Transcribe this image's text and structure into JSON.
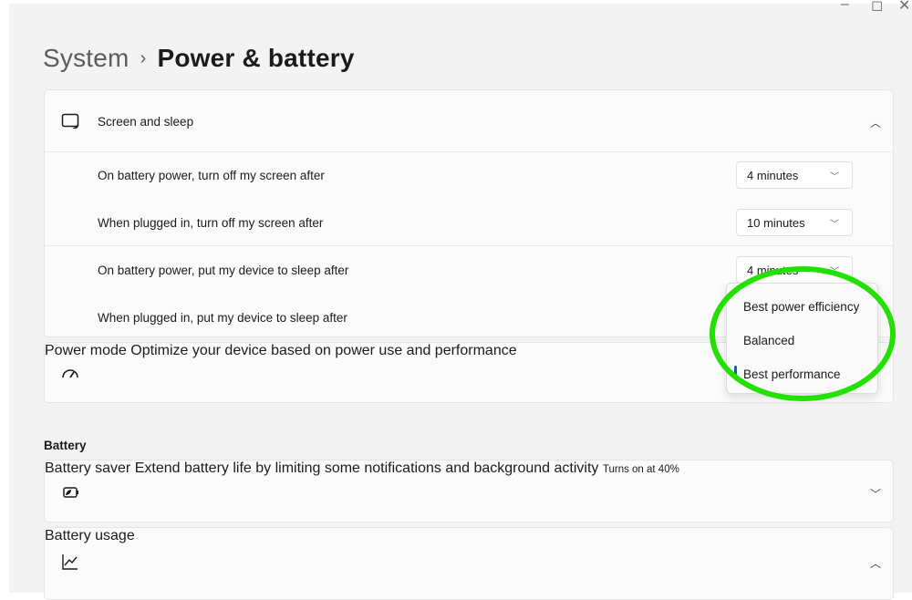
{
  "breadcrumb": {
    "root": "System",
    "separator": "›",
    "current": "Power & battery"
  },
  "screen_sleep": {
    "title": "Screen and sleep",
    "rows": [
      {
        "label": "On battery power, turn off my screen after",
        "value": "4 minutes"
      },
      {
        "label": "When plugged in, turn off my screen after",
        "value": "10 minutes"
      },
      {
        "label": "On battery power, put my device to sleep after",
        "value": "4 minutes"
      },
      {
        "label": "When plugged in, put my device to sleep after"
      }
    ]
  },
  "power_mode": {
    "title": "Power mode",
    "subtitle": "Optimize your device based on power use and performance",
    "options": [
      "Best power efficiency",
      "Balanced",
      "Best performance"
    ],
    "selected": "Best performance"
  },
  "battery_section": {
    "heading": "Battery"
  },
  "battery_saver": {
    "title": "Battery saver",
    "subtitle": "Extend battery life by limiting some notifications and background activity",
    "status": "Turns on at 40%"
  },
  "battery_usage": {
    "title": "Battery usage"
  },
  "colors": {
    "accent": "#0067c0",
    "highlight_ring": "#22e000"
  },
  "icons": {
    "screen_sleep": "screen-sleep-icon",
    "power_mode": "speedometer-icon",
    "battery_saver": "battery-leaf-icon",
    "battery_usage": "line-chart-icon"
  }
}
